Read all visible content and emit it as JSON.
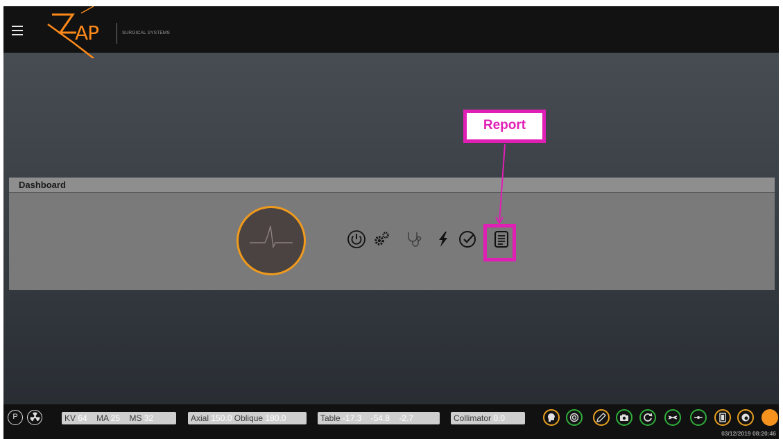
{
  "app": {
    "logo_text": "AP",
    "logo_subtitle": "SURGICAL SYSTEMS"
  },
  "dashboard": {
    "title": "Dashboard",
    "icons": [
      "power-icon",
      "gears-icon",
      "stethoscope-icon",
      "lightning-icon",
      "checkmark-icon",
      "report-icon"
    ]
  },
  "annotation": {
    "label": "Report",
    "color": "#e01fb4"
  },
  "status": {
    "kv_label": "KV",
    "kv_value": "64",
    "ma_label": "MA",
    "ma_value": "25",
    "ms_label": "MS",
    "ms_value": "32",
    "axial_label": "Axial",
    "axial_value": "150.0",
    "oblique_label": "Oblique",
    "oblique_value": "180.0",
    "table_label": "Table",
    "table_x": "-17.3",
    "table_y": "-54.8",
    "table_z": "-2.7",
    "collimator_label": "Collimator",
    "collimator_value": "0.0",
    "p_button": "P",
    "timestamp": "03/12/2019 08:20:46"
  },
  "colors": {
    "accent_orange": "#f5931e",
    "ring_green": "#2fae3a",
    "ring_orange": "#e9a020"
  }
}
